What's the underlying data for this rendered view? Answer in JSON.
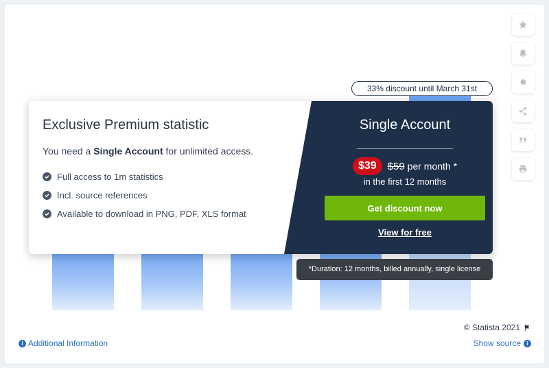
{
  "toolbar": {
    "items": [
      {
        "icon": "star-icon"
      },
      {
        "icon": "bell-icon"
      },
      {
        "icon": "gear-icon"
      },
      {
        "icon": "share-icon"
      },
      {
        "icon": "quote-icon"
      },
      {
        "icon": "print-icon"
      }
    ]
  },
  "promo": {
    "discount_label": "33% discount until March 31st"
  },
  "premium": {
    "title": "Exclusive Premium statistic",
    "need_prefix": "You need a ",
    "need_account": "Single Account",
    "need_suffix": " for unlimited access.",
    "features": [
      "Full access to 1m statistics",
      "Incl. source references",
      "Available to download in PNG, PDF, XLS format"
    ]
  },
  "offer": {
    "title": "Single Account",
    "new_price": "$39",
    "old_price": "$59",
    "per_month": "per month *",
    "period": "in the first 12 months",
    "cta_label": "Get discount now",
    "free_label": "View for free",
    "tooltip": "*Duration: 12 months, billed annually, single license"
  },
  "footer": {
    "copyright": "© Statista 2021",
    "additional_info": "Additional Information",
    "show_source": "Show source"
  },
  "colors": {
    "dark_panel": "#1e2f4a",
    "cta_green": "#6fb80a",
    "price_red": "#d00e1a",
    "link_blue": "#2a6ebf"
  }
}
